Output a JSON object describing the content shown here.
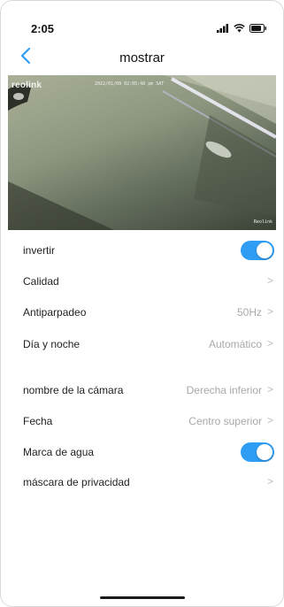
{
  "status_bar": {
    "time": "2:05"
  },
  "header": {
    "title": "mostrar"
  },
  "camera": {
    "logo": "reolink",
    "timestamp": "2022/01/08 02:05:48 pm SAT",
    "watermark": "Reolink"
  },
  "settings": {
    "invertir": {
      "label": "invertir",
      "toggle_on": true
    },
    "calidad": {
      "label": "Calidad",
      "value": ""
    },
    "antiparpadeo": {
      "label": "Antiparpadeo",
      "value": "50Hz"
    },
    "dia_noche": {
      "label": "Día y noche",
      "value": "Automático"
    },
    "nombre_camara": {
      "label": "nombre de la cámara",
      "value": "Derecha inferior"
    },
    "fecha": {
      "label": "Fecha",
      "value": "Centro superior"
    },
    "marca_agua": {
      "label": "Marca de agua",
      "toggle_on": true
    },
    "mascara": {
      "label": "máscara de privacidad",
      "value": ""
    }
  },
  "icons": {
    "back": "chevron-left-icon",
    "chevron": "chevron-right-icon",
    "signal": "signal-icon",
    "wifi": "wifi-icon",
    "battery": "battery-icon"
  },
  "colors": {
    "accent": "#2f9df4",
    "secondary_text": "#a8a8a8"
  }
}
